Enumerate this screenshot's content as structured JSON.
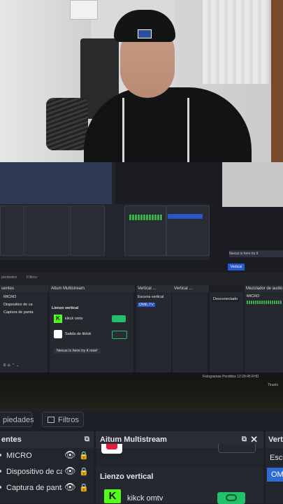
{
  "nested": {
    "sources_header": "uentes",
    "sources": [
      "MICRO",
      "Dispositivo de ca",
      "Captura de panta"
    ],
    "multistream_header": "Aitum Multistream",
    "vertical_canvas_label": "Lienzo vertical",
    "stream_kick": "kikck omtv",
    "stream_tiktok": "Salida de tiktok",
    "nexus_text": "Nexus is here try it now!",
    "vertical_header": "Vertical ...",
    "vertical_scene_header": "Vertical ...",
    "scenes": [
      "Escena vertical",
      "OME.TV"
    ],
    "mixer_header": "Mezclador de audio",
    "mixer_track": "MICRO",
    "mixer_select": "Desconectado",
    "vertical_button": "Vertical",
    "nexus_right": "Nexus is here try it",
    "props_tab": "piedades",
    "filters_tab": "Filtros",
    "status_text": "Fotogramas Perdidos 12:29:45 FHD",
    "timeline_label": "Tiruelo"
  },
  "toolbar": {
    "properties_tab": "piedades",
    "filters_tab": "Filtros"
  },
  "sources_dock": {
    "title": "entes",
    "items": [
      "MICRO",
      "Dispositivo de ca",
      "Captura de panta"
    ]
  },
  "multistream_dock": {
    "title": "Aitum Multistream",
    "vertical_canvas_label": "Lienzo vertical",
    "output_name": "kikck omtv"
  },
  "vertical_dock": {
    "title": "Vert",
    "scene_partial": "Esce",
    "selected_partial": "OM"
  },
  "colors": {
    "accent_blue": "#2e6bd6",
    "kick_green": "#53fc18",
    "toggle_green": "#21c06b",
    "panel_bg": "#23252c"
  }
}
